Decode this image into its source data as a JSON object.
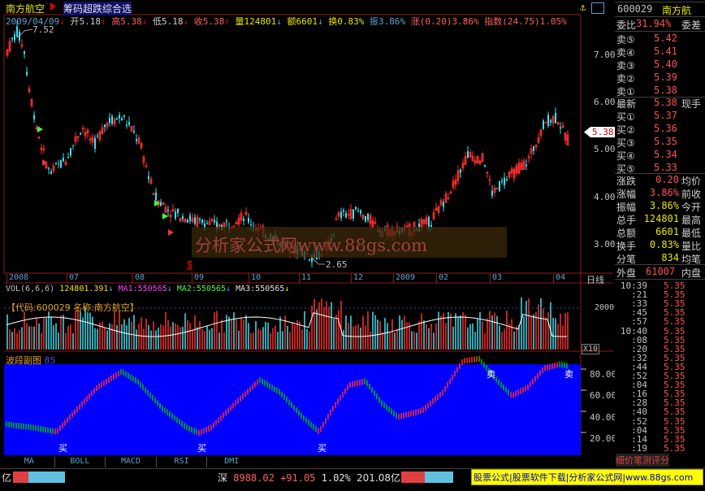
{
  "stock": {
    "name": "南方航空",
    "code": "600029",
    "name_short": "南方航"
  },
  "strategy_title": "筹码超跌综合选",
  "info_bar": {
    "date": "2009/04/09",
    "open": "开5.18",
    "high": "高5.38",
    "low": "低5.18",
    "close": "收5.38",
    "volume": "量124801",
    "amount": "额6601",
    "turnover": "换0.83%",
    "amplitude": "振3.86%",
    "change": "涨(0.20)3.86%",
    "index": "指数(24.75)1.05%"
  },
  "price_axis": {
    "ticks": [
      "7.00",
      "6.00",
      "5.00",
      "4.00",
      "3.00"
    ],
    "high_label": "7.52",
    "low_label": "2.65",
    "current_price": "5.38"
  },
  "time_axis": {
    "labels": [
      "2008",
      "07",
      "08",
      "09",
      "10",
      "11",
      "12",
      "2009",
      "02",
      "03",
      "04"
    ],
    "mode": "日线"
  },
  "volume_bar": {
    "label": "VOL(6,6,6)",
    "vol": "124801.391",
    "ma1": "MA1:550565",
    "ma2": "MA2:550565",
    "ma3": "MA3:550565"
  },
  "volume_overlay": "【代码:600029 名称:南方航空】",
  "volume_axis": {
    "tick": "200000",
    "unit": "X10"
  },
  "sub_chart": {
    "title": "波段副图",
    "id": "85",
    "ticks": [
      "80.00",
      "60.00",
      "40.00",
      "20.00"
    ],
    "buy": "买",
    "sell": "卖"
  },
  "watermark": "分析家公式网www.88gs.com",
  "signal_s": "S",
  "tabs": [
    "MA",
    "BOLL",
    "MACD",
    "RSI",
    "DMI"
  ],
  "status": {
    "left": "亿",
    "market": "深",
    "index": "8988.02",
    "change": "+91.05",
    "pct": "1.02%",
    "amount": "201.08亿"
  },
  "promo": "股票公式|股票软件下载|分析家公式网|www.88gs.com",
  "quote": {
    "weibi_label": "委比",
    "weibi_val": "31.94%",
    "weicha_label": "委差",
    "asks": [
      {
        "l": "卖⑤",
        "p": "5.42"
      },
      {
        "l": "卖④",
        "p": "5.41"
      },
      {
        "l": "卖③",
        "p": "5.40"
      },
      {
        "l": "卖②",
        "p": "5.39"
      },
      {
        "l": "卖①",
        "p": "5.38"
      }
    ],
    "last_label": "最新",
    "last_val": "5.38",
    "last_right": "现手",
    "bids": [
      {
        "l": "买①",
        "p": "5.37"
      },
      {
        "l": "买②",
        "p": "5.36"
      },
      {
        "l": "买③",
        "p": "5.35"
      },
      {
        "l": "买④",
        "p": "5.34"
      },
      {
        "l": "买⑤",
        "p": "5.33"
      }
    ],
    "stats": [
      {
        "l": "涨跌",
        "v": "0.20",
        "r": "均价"
      },
      {
        "l": "涨幅",
        "v": "3.86%",
        "r": "前收"
      },
      {
        "l": "振幅",
        "v": "3.86%",
        "r": "今开"
      },
      {
        "l": "总手",
        "v": "124801",
        "r": "最高"
      },
      {
        "l": "总额",
        "v": "6601",
        "r": "最低"
      },
      {
        "l": "换手",
        "v": "0.83%",
        "r": "量比"
      },
      {
        "l": "分笔",
        "v": "834",
        "r": "均笔"
      }
    ],
    "outer_label": "外盘",
    "outer_val": "61007",
    "inner_label": "内盘"
  },
  "ticks": [
    {
      "t": "10:39",
      "p": "5.35"
    },
    {
      "t": ":21",
      "p": "5.35"
    },
    {
      "t": ":33",
      "p": "5.35"
    },
    {
      "t": ":45",
      "p": "5.35"
    },
    {
      "t": ":57",
      "p": "5.35"
    },
    {
      "t": "10:40",
      "p": "5.35"
    },
    {
      "t": ":08",
      "p": "5.35"
    },
    {
      "t": ":20",
      "p": "5.35"
    },
    {
      "t": ":32",
      "p": "5.35"
    },
    {
      "t": ":44",
      "p": "5.35"
    },
    {
      "t": ":52",
      "p": "5.35"
    },
    {
      "t": ":04",
      "p": "5.35"
    },
    {
      "t": ":16",
      "p": "5.35"
    },
    {
      "t": ":28",
      "p": "5.35"
    },
    {
      "t": ":40",
      "p": "5.35"
    },
    {
      "t": ":52",
      "p": "5.35"
    },
    {
      "t": ":04",
      "p": "5.35"
    },
    {
      "t": ":14",
      "p": "5.35"
    },
    {
      "t": ":19",
      "p": "5.35"
    }
  ],
  "bottom_right_tabs": "细价笔测评分"
}
